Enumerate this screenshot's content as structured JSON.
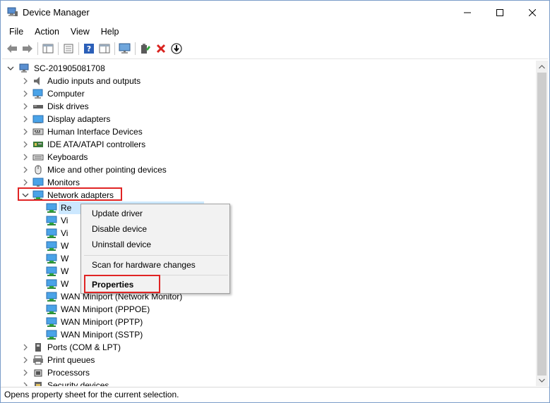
{
  "window": {
    "title": "Device Manager"
  },
  "menu": [
    "File",
    "Action",
    "View",
    "Help"
  ],
  "toolbar_icons": [
    "back-icon",
    "forward-icon",
    "show-hide-console-tree-icon",
    "properties-icon",
    "help-icon",
    "action-pane-icon",
    "monitor-icon",
    "update-driver-icon",
    "uninstall-icon",
    "disable-icon"
  ],
  "tree": {
    "root": "SC-201905081708",
    "categories": [
      {
        "label": "Audio inputs and outputs",
        "icon": "speaker-icon"
      },
      {
        "label": "Computer",
        "icon": "computer-icon"
      },
      {
        "label": "Disk drives",
        "icon": "disk-drive-icon"
      },
      {
        "label": "Display adapters",
        "icon": "display-adapter-icon"
      },
      {
        "label": "Human Interface Devices",
        "icon": "hid-icon"
      },
      {
        "label": "IDE ATA/ATAPI controllers",
        "icon": "ide-controller-icon"
      },
      {
        "label": "Keyboards",
        "icon": "keyboard-icon"
      },
      {
        "label": "Mice and other pointing devices",
        "icon": "mouse-icon"
      },
      {
        "label": "Monitors",
        "icon": "monitor-icon"
      },
      {
        "label": "Network adapters",
        "icon": "network-adapter-icon"
      }
    ],
    "network_children": [
      {
        "label": "Re"
      },
      {
        "label": "Vi"
      },
      {
        "label": "Vi"
      },
      {
        "label": "W"
      },
      {
        "label": "W"
      },
      {
        "label": "W"
      },
      {
        "label": "W"
      },
      {
        "label": "WAN Miniport (Network Monitor)"
      },
      {
        "label": "WAN Miniport (PPPOE)"
      },
      {
        "label": "WAN Miniport (PPTP)"
      },
      {
        "label": "WAN Miniport (SSTP)"
      }
    ],
    "after": [
      {
        "label": "Ports (COM & LPT)",
        "icon": "port-icon"
      },
      {
        "label": "Print queues",
        "icon": "printer-icon"
      },
      {
        "label": "Processors",
        "icon": "processor-icon"
      },
      {
        "label": "Security devices",
        "icon": "security-device-icon"
      }
    ]
  },
  "context_menu": {
    "update": "Update driver",
    "disable": "Disable device",
    "uninstall": "Uninstall device",
    "scan": "Scan for hardware changes",
    "properties": "Properties"
  },
  "status": "Opens property sheet for the current selection."
}
